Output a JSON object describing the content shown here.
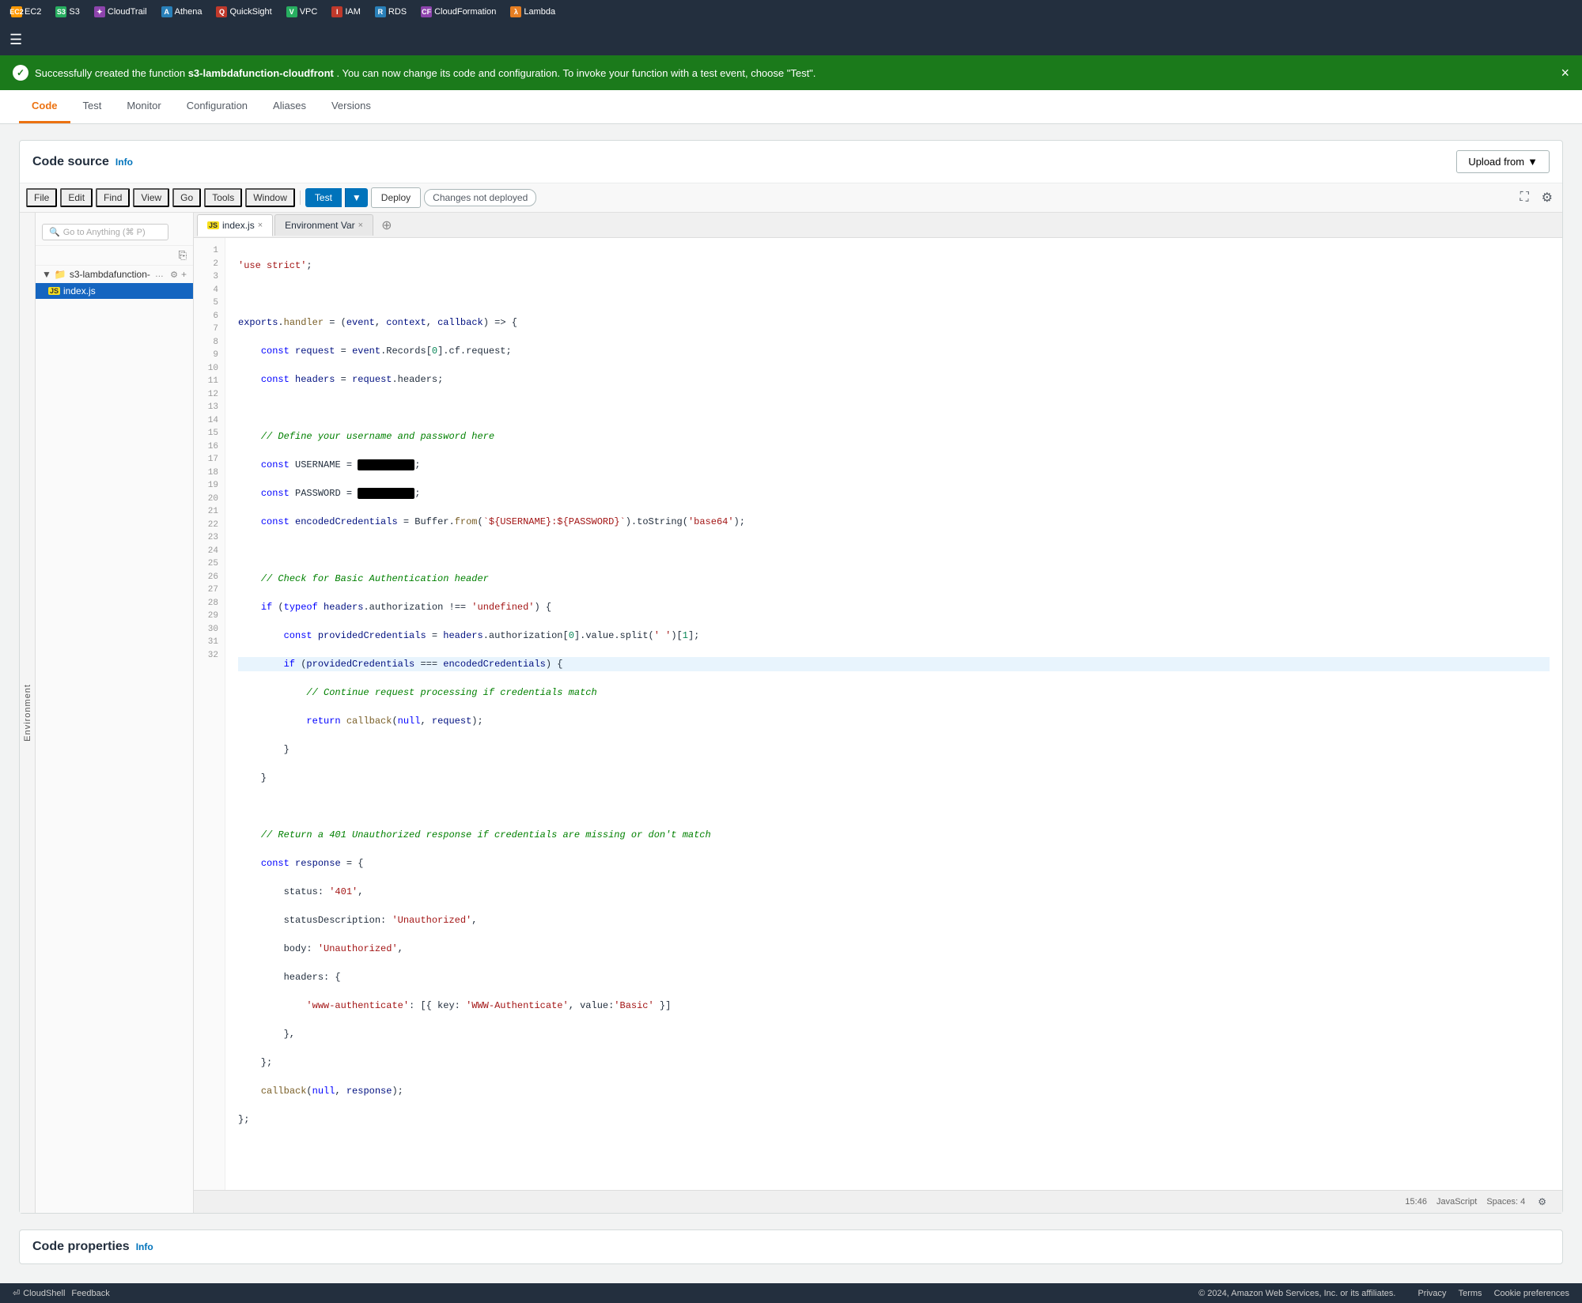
{
  "topnav": {
    "items": [
      {
        "id": "ec2",
        "label": "EC2",
        "iconClass": "ec2",
        "iconText": "EC2"
      },
      {
        "id": "s3",
        "label": "S3",
        "iconClass": "s3",
        "iconText": "S3"
      },
      {
        "id": "cloudtrail",
        "label": "CloudTrail",
        "iconClass": "cloudtrail",
        "iconText": "CT"
      },
      {
        "id": "athena",
        "label": "Athena",
        "iconClass": "athena",
        "iconText": "A"
      },
      {
        "id": "quicksight",
        "label": "QuickSight",
        "iconClass": "quicksight",
        "iconText": "QS"
      },
      {
        "id": "vpc",
        "label": "VPC",
        "iconClass": "vpc",
        "iconText": "VPC"
      },
      {
        "id": "iam",
        "label": "IAM",
        "iconClass": "iam",
        "iconText": "IAM"
      },
      {
        "id": "rds",
        "label": "RDS",
        "iconClass": "rds",
        "iconText": "RDS"
      },
      {
        "id": "cloudformation",
        "label": "CloudFormation",
        "iconClass": "cloudformation",
        "iconText": "CF"
      },
      {
        "id": "lambda",
        "label": "Lambda",
        "iconClass": "lambda",
        "iconText": "λ"
      }
    ]
  },
  "banner": {
    "message_prefix": "Successfully created the function",
    "function_name": "s3-lambdafunction-cloudfront",
    "message_suffix": ". You can now change its code and configuration. To invoke your function with a test event, choose \"Test\"."
  },
  "tabs": [
    {
      "id": "code",
      "label": "Code",
      "active": true
    },
    {
      "id": "test",
      "label": "Test"
    },
    {
      "id": "monitor",
      "label": "Monitor"
    },
    {
      "id": "configuration",
      "label": "Configuration"
    },
    {
      "id": "aliases",
      "label": "Aliases"
    },
    {
      "id": "versions",
      "label": "Versions"
    }
  ],
  "code_source": {
    "title": "Code source",
    "info_label": "Info",
    "upload_from_label": "Upload from",
    "upload_dropdown": "▼"
  },
  "toolbar": {
    "menu_items": [
      "File",
      "Edit",
      "Find",
      "View",
      "Go",
      "Tools",
      "Window"
    ],
    "test_label": "Test",
    "deploy_label": "Deploy",
    "changes_label": "Changes not deployed",
    "expand_icon": "⛶",
    "settings_icon": "⚙"
  },
  "editor": {
    "tabs": [
      {
        "id": "index-js",
        "label": "index.js",
        "active": true
      },
      {
        "id": "env-var",
        "label": "Environment Var"
      }
    ],
    "search_placeholder": "Go to Anything (⌘ P)"
  },
  "file_tree": {
    "folder_name": "s3-lambdafunction-",
    "files": [
      {
        "name": "index.js",
        "active": true
      }
    ]
  },
  "code_lines": [
    {
      "num": 1,
      "text": "'use strict';",
      "tokens": [
        {
          "t": "str",
          "v": "'use strict'"
        },
        {
          "t": "",
          "v": ";"
        }
      ]
    },
    {
      "num": 2,
      "text": ""
    },
    {
      "num": 3,
      "text": "exports.handler = (event, context, callback) => {",
      "highlighted": false
    },
    {
      "num": 4,
      "text": "    const request = event.Records[0].cf.request;"
    },
    {
      "num": 5,
      "text": "    const headers = request.headers;"
    },
    {
      "num": 6,
      "text": ""
    },
    {
      "num": 7,
      "text": "    // Define your username and password here",
      "comment": true
    },
    {
      "num": 8,
      "text": "    const USERNAME = [REDACTED];",
      "has_redacted": true
    },
    {
      "num": 9,
      "text": "    const PASSWORD = [REDACTED];",
      "has_redacted": true
    },
    {
      "num": 10,
      "text": "    const encodedCredentials = Buffer.from(`${USERNAME}:${PASSWORD}`).toString('base64');"
    },
    {
      "num": 11,
      "text": ""
    },
    {
      "num": 12,
      "text": "    // Check for Basic Authentication header",
      "comment": true
    },
    {
      "num": 13,
      "text": "    if (typeof headers.authorization !== 'undefined') {"
    },
    {
      "num": 14,
      "text": "        const providedCredentials = headers.authorization[0].value.split(' ')[1];",
      "highlighted": false
    },
    {
      "num": 15,
      "text": "        if (providedCredentials === encodedCredentials) {",
      "highlighted": true
    },
    {
      "num": 16,
      "text": "            // Continue request processing if credentials match",
      "comment": true
    },
    {
      "num": 17,
      "text": "            return callback(null, request);"
    },
    {
      "num": 18,
      "text": "        }"
    },
    {
      "num": 19,
      "text": "    }"
    },
    {
      "num": 20,
      "text": ""
    },
    {
      "num": 21,
      "text": "    // Return a 401 Unauthorized response if credentials are missing or don't match",
      "comment": true
    },
    {
      "num": 22,
      "text": "    const response = {"
    },
    {
      "num": 23,
      "text": "        status: '401',"
    },
    {
      "num": 24,
      "text": "        statusDescription: 'Unauthorized',"
    },
    {
      "num": 25,
      "text": "        body: 'Unauthorized',"
    },
    {
      "num": 26,
      "text": "        headers: {"
    },
    {
      "num": 27,
      "text": "            'www-authenticate': [{ key: 'WWW-Authenticate', value:'Basic' }]"
    },
    {
      "num": 28,
      "text": "        },"
    },
    {
      "num": 29,
      "text": "    };"
    },
    {
      "num": 30,
      "text": "    callback(null, response);"
    },
    {
      "num": 31,
      "text": "};"
    },
    {
      "num": 32,
      "text": ""
    }
  ],
  "status_bar": {
    "position": "15:46",
    "language": "JavaScript",
    "spaces": "Spaces: 4",
    "settings_icon": "⚙"
  },
  "code_properties": {
    "title": "Code properties",
    "info_label": "Info"
  },
  "bottom_bar": {
    "cloudshell_label": "CloudShell",
    "feedback_label": "Feedback",
    "copyright": "© 2024, Amazon Web Services, Inc. or its affiliates.",
    "links": [
      "Privacy",
      "Terms",
      "Cookie preferences"
    ]
  }
}
